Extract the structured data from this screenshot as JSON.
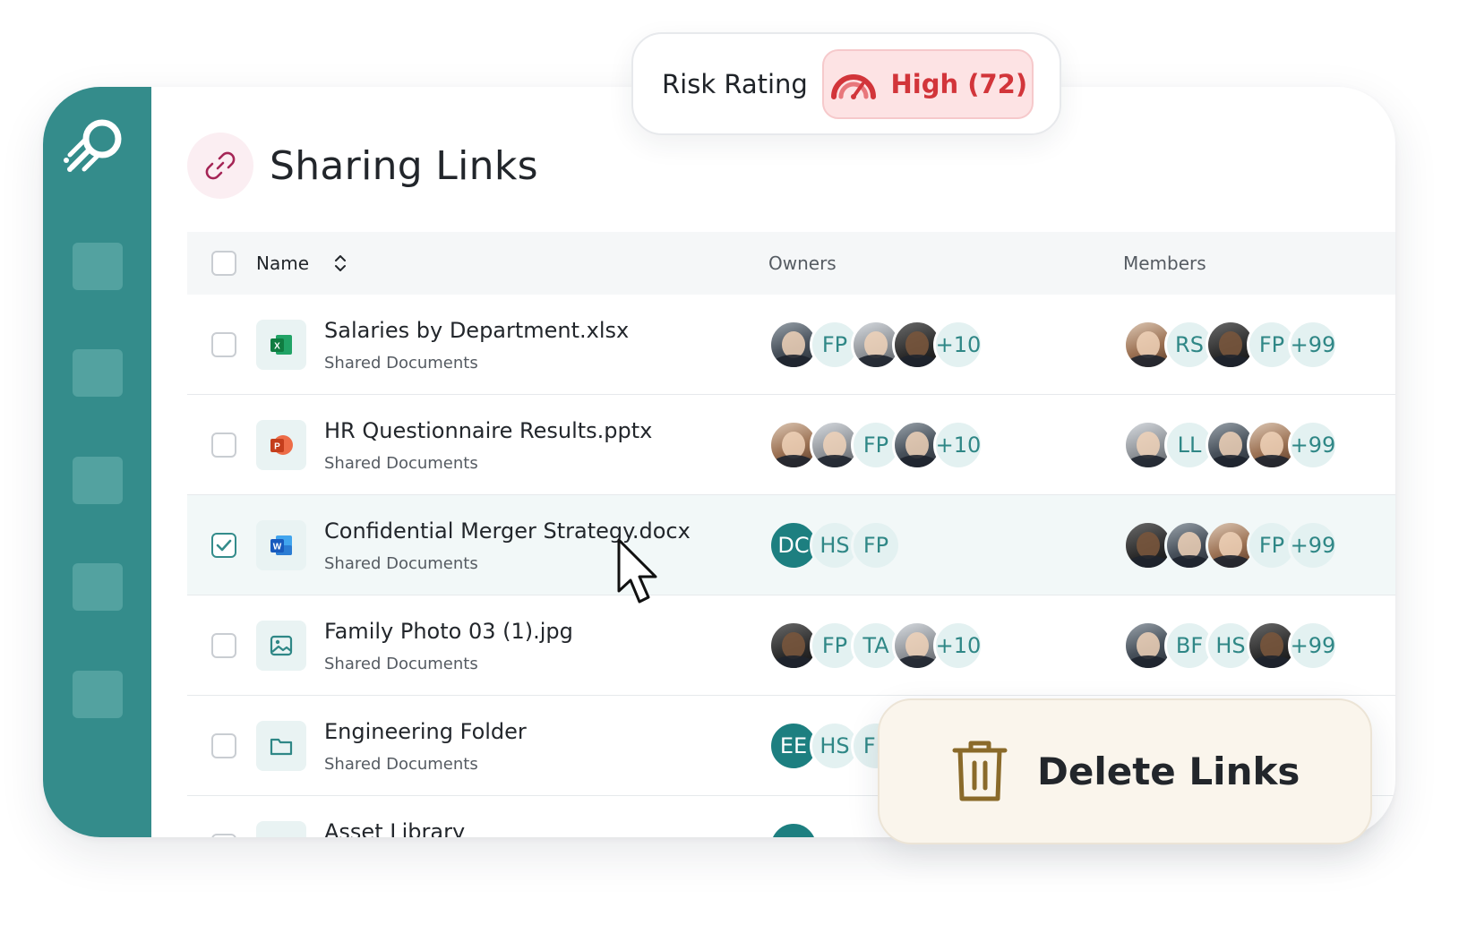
{
  "page": {
    "title": "Sharing Links"
  },
  "table": {
    "columns": {
      "name": "Name",
      "owners": "Owners",
      "members": "Members"
    },
    "rows": [
      {
        "name": "Salaries by Department.xlsx",
        "location": "Shared Documents",
        "file_type": "excel-icon",
        "selected": false,
        "owners": [
          {
            "type": "photo"
          },
          {
            "type": "initials",
            "text": "FP"
          },
          {
            "type": "photo"
          },
          {
            "type": "photo"
          },
          {
            "type": "count",
            "text": "+10"
          }
        ],
        "members": [
          {
            "type": "photo"
          },
          {
            "type": "initials",
            "text": "RS"
          },
          {
            "type": "photo"
          },
          {
            "type": "initials",
            "text": "FP"
          },
          {
            "type": "count",
            "text": "+99"
          }
        ]
      },
      {
        "name": "HR Questionnaire Results.pptx",
        "location": "Shared Documents",
        "file_type": "powerpoint-icon",
        "selected": false,
        "owners": [
          {
            "type": "photo"
          },
          {
            "type": "photo"
          },
          {
            "type": "initials",
            "text": "FP"
          },
          {
            "type": "photo"
          },
          {
            "type": "count",
            "text": "+10"
          }
        ],
        "members": [
          {
            "type": "photo"
          },
          {
            "type": "initials",
            "text": "LL"
          },
          {
            "type": "photo"
          },
          {
            "type": "photo"
          },
          {
            "type": "count",
            "text": "+99"
          }
        ]
      },
      {
        "name": "Confidential Merger Strategy.docx",
        "location": "Shared Documents",
        "file_type": "word-icon",
        "selected": true,
        "owners": [
          {
            "type": "dark",
            "text": "DC"
          },
          {
            "type": "initials",
            "text": "HS"
          },
          {
            "type": "initials",
            "text": "FP"
          }
        ],
        "members": [
          {
            "type": "photo"
          },
          {
            "type": "photo"
          },
          {
            "type": "photo"
          },
          {
            "type": "initials",
            "text": "FP"
          },
          {
            "type": "count",
            "text": "+99"
          }
        ]
      },
      {
        "name": "Family Photo 03 (1).jpg",
        "location": "Shared Documents",
        "file_type": "image-icon",
        "selected": false,
        "owners": [
          {
            "type": "photo"
          },
          {
            "type": "initials",
            "text": "FP"
          },
          {
            "type": "initials",
            "text": "TA"
          },
          {
            "type": "photo"
          },
          {
            "type": "count",
            "text": "+10"
          }
        ],
        "members": [
          {
            "type": "photo"
          },
          {
            "type": "initials",
            "text": "BF"
          },
          {
            "type": "initials",
            "text": "HS"
          },
          {
            "type": "photo"
          },
          {
            "type": "count",
            "text": "+99"
          }
        ]
      },
      {
        "name": "Engineering Folder",
        "location": "Shared Documents",
        "file_type": "folder-icon",
        "selected": false,
        "owners": [
          {
            "type": "dark",
            "text": "EE"
          },
          {
            "type": "initials",
            "text": "HS"
          },
          {
            "type": "initials",
            "text": "FP"
          }
        ],
        "members": []
      },
      {
        "name": "Asset Library",
        "location": "",
        "file_type": "library-icon",
        "selected": false,
        "owners": [
          {
            "type": "dark",
            "text": ""
          }
        ],
        "members": []
      }
    ]
  },
  "risk": {
    "label": "Risk Rating",
    "value": "High (72)",
    "icon": "gauge-icon",
    "color": "#d2353a"
  },
  "actions": {
    "delete_label": "Delete Links",
    "delete_icon": "trash-icon"
  },
  "colors": {
    "brand": "#348c8b",
    "selected_row": "#f2f8f8",
    "risk_bg": "#fde3e4",
    "delete_bg": "#faf5ec"
  }
}
